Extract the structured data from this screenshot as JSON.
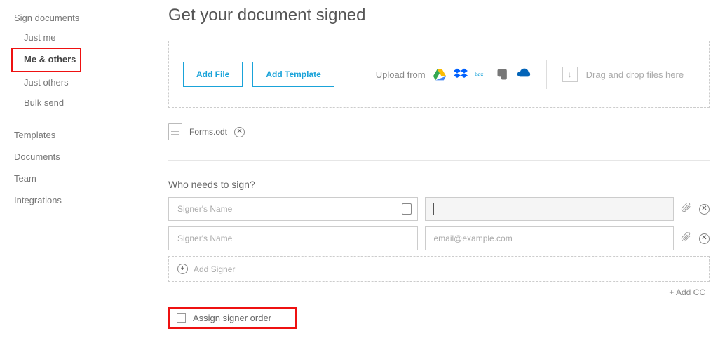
{
  "sidebar": {
    "sign_section": "Sign documents",
    "items": [
      "Just me",
      "Me & others",
      "Just others",
      "Bulk send"
    ],
    "active_index": 1,
    "other": [
      "Templates",
      "Documents",
      "Team",
      "Integrations"
    ]
  },
  "header": {
    "title": "Get your document signed"
  },
  "upload": {
    "add_file": "Add File",
    "add_template": "Add Template",
    "upload_from": "Upload from",
    "dragdrop": "Drag and drop files here"
  },
  "file": {
    "name": "Forms.odt"
  },
  "signers": {
    "section_label": "Who needs to sign?",
    "name_placeholder": "Signer's Name",
    "email_placeholder": "email@example.com",
    "add_signer": "Add Signer",
    "add_cc": "+ Add CC",
    "assign_order": "Assign signer order"
  }
}
